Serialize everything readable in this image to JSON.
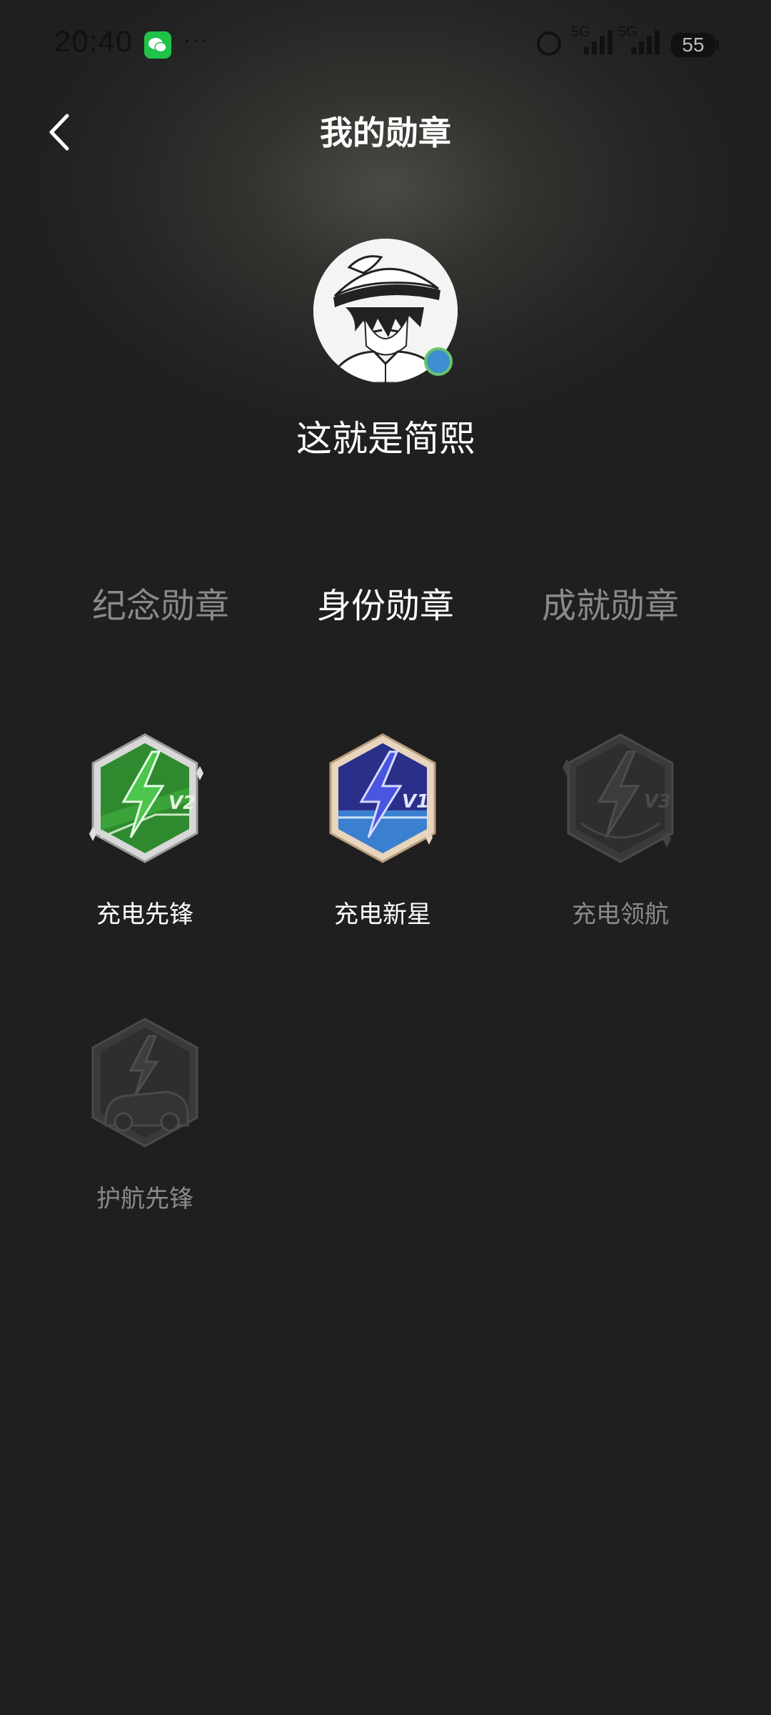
{
  "status_bar": {
    "time": "20:40",
    "more": "···",
    "signal1_label": "5G",
    "signal2_label": "5G",
    "battery": "55"
  },
  "header": {
    "title": "我的勋章"
  },
  "profile": {
    "username": "这就是简熙"
  },
  "tabs": [
    {
      "label": "纪念勋章",
      "active": false
    },
    {
      "label": "身份勋章",
      "active": true
    },
    {
      "label": "成就勋章",
      "active": false
    }
  ],
  "badges": [
    {
      "name": "充电先锋",
      "level": "V2",
      "unlocked": true,
      "color": "#2f8a2f"
    },
    {
      "name": "充电新星",
      "level": "V1",
      "unlocked": true,
      "color": "#3b45c9"
    },
    {
      "name": "充电领航",
      "level": "V3",
      "unlocked": false,
      "color": "#333333"
    },
    {
      "name": "护航先锋",
      "level": "",
      "unlocked": false,
      "color": "#333333"
    }
  ],
  "colors": {
    "background": "#1f1f1f",
    "text_active": "#ffffff",
    "text_inactive": "#8a8a8a"
  }
}
